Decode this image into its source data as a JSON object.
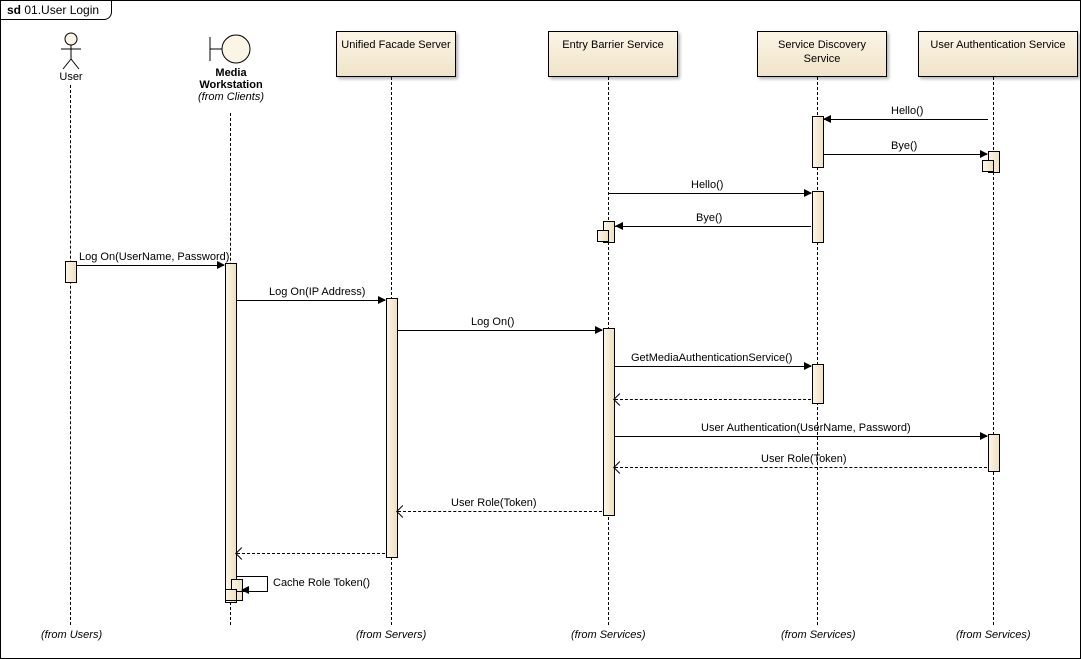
{
  "frame": {
    "title": "sd 01.User Login"
  },
  "lifelines": {
    "user": {
      "name": "User",
      "from": "(from Users)"
    },
    "media": {
      "name": "Media",
      "name2": "Workstation",
      "from": "(from Clients)"
    },
    "facade": {
      "name": "Unified Facade Server",
      "from": "(from Servers)"
    },
    "entry": {
      "name": "Entry Barrier Service",
      "from": "(from Services)"
    },
    "discovery": {
      "name": "Service Discovery Service",
      "from": "(from Services)"
    },
    "auth": {
      "name": "User Authentication Service",
      "from": "(from Services)"
    }
  },
  "messages": {
    "hello1": "Hello()",
    "bye1": "Bye()",
    "hello2": "Hello()",
    "bye2": "Bye()",
    "logon1": "Log On(UserName, Password)",
    "logon2": "Log On(IP Address)",
    "logon3": "Log On()",
    "getservice": "GetMediaAuthenticationService()",
    "userauth": "User Authentication(UserName, Password)",
    "userrole1": "User Role(Token)",
    "userrole2": "User Role(Token)",
    "cache": "Cache Role Token()"
  },
  "chart_data": {
    "type": "sequence-diagram",
    "title": "sd 01.User Login",
    "participants": [
      {
        "id": "user",
        "name": "User",
        "kind": "actor",
        "group": "Users"
      },
      {
        "id": "media",
        "name": "Media Workstation",
        "kind": "boundary",
        "group": "Clients"
      },
      {
        "id": "facade",
        "name": "Unified Facade Server",
        "kind": "component",
        "group": "Servers"
      },
      {
        "id": "entry",
        "name": "Entry Barrier Service",
        "kind": "component",
        "group": "Services"
      },
      {
        "id": "discovery",
        "name": "Service Discovery Service",
        "kind": "component",
        "group": "Services"
      },
      {
        "id": "auth",
        "name": "User Authentication Service",
        "kind": "component",
        "group": "Services"
      }
    ],
    "messages": [
      {
        "from": "auth",
        "to": "discovery",
        "label": "Hello()",
        "type": "sync"
      },
      {
        "from": "discovery",
        "to": "auth",
        "label": "Bye()",
        "type": "sync"
      },
      {
        "from": "entry",
        "to": "discovery",
        "label": "Hello()",
        "type": "sync"
      },
      {
        "from": "discovery",
        "to": "entry",
        "label": "Bye()",
        "type": "sync"
      },
      {
        "from": "user",
        "to": "media",
        "label": "Log On(UserName, Password)",
        "type": "sync"
      },
      {
        "from": "media",
        "to": "facade",
        "label": "Log On(IP Address)",
        "type": "sync"
      },
      {
        "from": "facade",
        "to": "entry",
        "label": "Log On()",
        "type": "sync"
      },
      {
        "from": "entry",
        "to": "discovery",
        "label": "GetMediaAuthenticationService()",
        "type": "sync"
      },
      {
        "from": "discovery",
        "to": "entry",
        "label": "",
        "type": "return"
      },
      {
        "from": "entry",
        "to": "auth",
        "label": "User Authentication(UserName, Password)",
        "type": "sync"
      },
      {
        "from": "auth",
        "to": "entry",
        "label": "User Role(Token)",
        "type": "return"
      },
      {
        "from": "entry",
        "to": "facade",
        "label": "User Role(Token)",
        "type": "return"
      },
      {
        "from": "facade",
        "to": "media",
        "label": "",
        "type": "return"
      },
      {
        "from": "media",
        "to": "media",
        "label": "Cache Role Token()",
        "type": "self"
      }
    ]
  }
}
